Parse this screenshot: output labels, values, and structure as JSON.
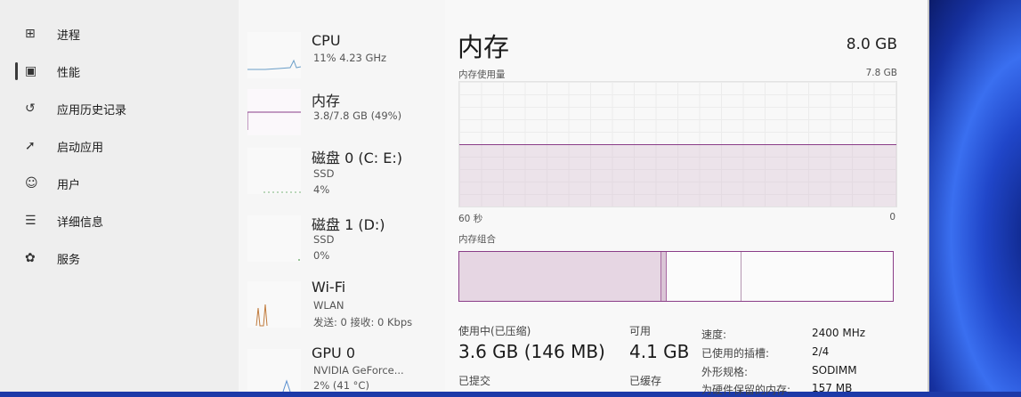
{
  "nav": {
    "items": [
      {
        "label": "进程",
        "icon": "processes-icon",
        "glyph": "⊞"
      },
      {
        "label": "性能",
        "icon": "performance-icon",
        "glyph": "▣"
      },
      {
        "label": "应用历史记录",
        "icon": "history-icon",
        "glyph": "↺"
      },
      {
        "label": "启动应用",
        "icon": "startup-icon",
        "glyph": "➚"
      },
      {
        "label": "用户",
        "icon": "users-icon",
        "glyph": "☺"
      },
      {
        "label": "详细信息",
        "icon": "details-icon",
        "glyph": "☰"
      },
      {
        "label": "服务",
        "icon": "services-icon",
        "glyph": "✿"
      }
    ],
    "active_index": 1
  },
  "perf_list": [
    {
      "title": "CPU",
      "lines": [
        "11% 4.23 GHz"
      ]
    },
    {
      "title": "内存",
      "lines": [
        "3.8/7.8 GB (49%)"
      ]
    },
    {
      "title": "磁盘 0 (C: E:)",
      "lines": [
        "SSD",
        "4%"
      ]
    },
    {
      "title": "磁盘 1 (D:)",
      "lines": [
        "SSD",
        "0%"
      ]
    },
    {
      "title": "Wi-Fi",
      "lines": [
        "WLAN",
        "发送: 0 接收: 0 Kbps"
      ]
    },
    {
      "title": "GPU 0",
      "lines": [
        "NVIDIA GeForce...",
        "2% (41 °C)"
      ]
    }
  ],
  "main": {
    "title": "内存",
    "total": "8.0 GB",
    "usage_label": "内存使用量",
    "usage_max": "7.8 GB",
    "axis_left": "60 秒",
    "axis_right": "0",
    "composition_label": "内存组合",
    "in_use_label": "使用中(已压缩)",
    "in_use_value": "3.6 GB (146 MB)",
    "available_label": "可用",
    "available_value": "4.1 GB",
    "committed_label": "已提交",
    "cached_label": "已缓存",
    "specs": [
      {
        "k": "速度:",
        "v": "2400 MHz"
      },
      {
        "k": "已使用的插槽:",
        "v": "2/4"
      },
      {
        "k": "外形规格:",
        "v": "SODIMM"
      },
      {
        "k": "为硬件保留的内存:",
        "v": "157 MB"
      }
    ],
    "usage_percent": 49
  }
}
